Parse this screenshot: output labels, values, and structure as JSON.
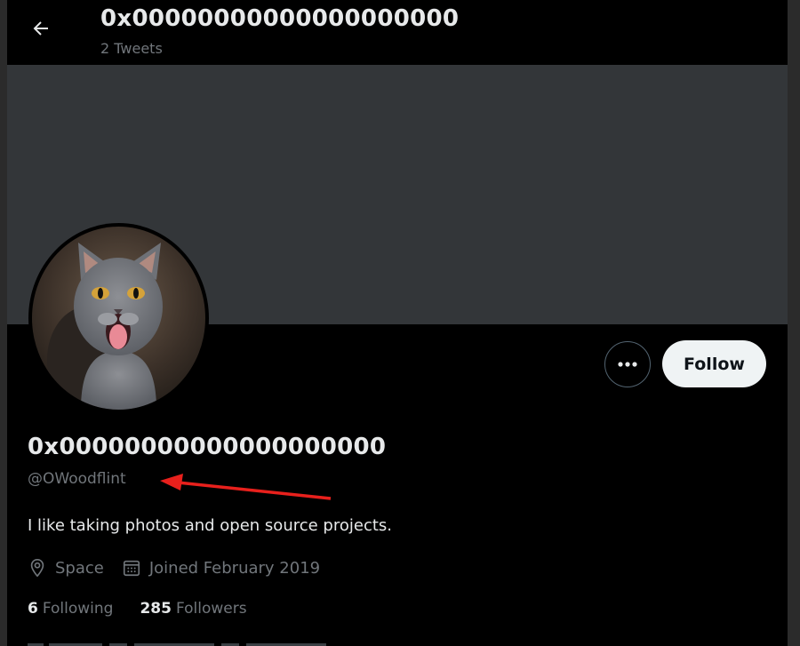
{
  "header": {
    "title": "0x00000000000000000000",
    "subtitle": "2 Tweets"
  },
  "profile": {
    "display_name": "0x00000000000000000000",
    "handle": "@OWoodflint",
    "bio": "I like taking photos and open source projects.",
    "location": "Space",
    "joined": "Joined February 2019",
    "following_count": "6",
    "following_label": "Following",
    "followers_count": "285",
    "followers_label": "Followers"
  },
  "actions": {
    "follow_label": "Follow",
    "more_label": "•••"
  },
  "icons": {
    "back": "back-arrow-icon",
    "more": "more-options-icon",
    "location": "location-pin-icon",
    "calendar": "calendar-icon"
  },
  "colors": {
    "annotation": "#e8201c",
    "background": "#000000",
    "banner": "#333639",
    "secondary_text": "#71767b"
  }
}
